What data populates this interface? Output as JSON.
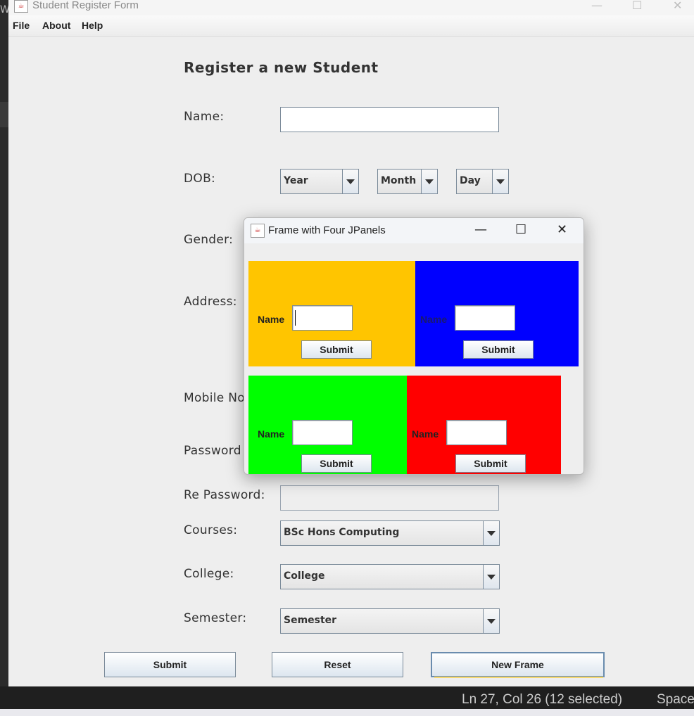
{
  "background": {
    "status_text": "Ln 27, Col 26 (12 selected)",
    "space_text": "Space",
    "left_letter": "W"
  },
  "main_window": {
    "title": "Student Register Form",
    "menu": [
      "File",
      "About",
      "Help"
    ],
    "heading": "Register a new Student",
    "labels": {
      "name": "Name:",
      "dob": "DOB:",
      "gender": "Gender:",
      "address": "Address:",
      "mobile": "Mobile No",
      "password": "Password",
      "repassword": "Re Password:",
      "courses": "Courses:",
      "college": "College:",
      "semester": "Semester:"
    },
    "name_value": "",
    "dob": {
      "year": "Year",
      "month": "Month",
      "day": "Day"
    },
    "courses_selected": "BSc Hons Computing",
    "college_selected": "College",
    "semester_selected": "Semester",
    "buttons": {
      "submit": "Submit",
      "reset": "Reset",
      "new_frame": "New Frame"
    }
  },
  "popup": {
    "title": "Frame with Four JPanels",
    "panels": [
      {
        "color": "#ffc500",
        "label": "Name",
        "label_color": "#222222",
        "button": "Submit"
      },
      {
        "color": "#0000ff",
        "label": "Name",
        "label_color": "#1a1a6e",
        "button": "Submit"
      },
      {
        "color": "#00ff00",
        "label": "Name",
        "label_color": "#222222",
        "button": "Submit"
      },
      {
        "color": "#ff0000",
        "label": "Name",
        "label_color": "#222222",
        "button": "Submit"
      }
    ]
  }
}
